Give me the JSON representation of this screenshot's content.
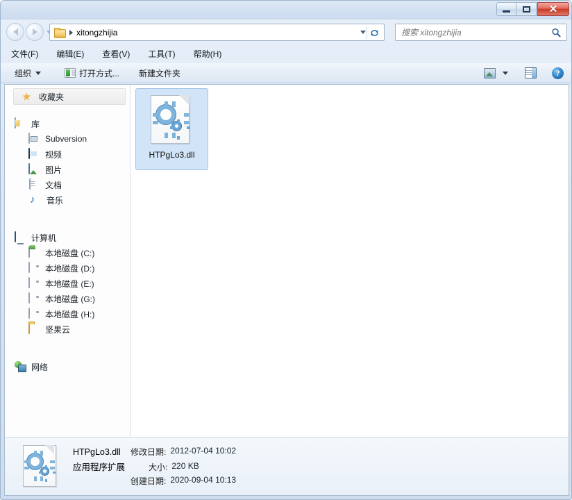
{
  "window": {
    "controls": {
      "minimize_label": "—",
      "maximize_label": "□",
      "close_label": "✕"
    }
  },
  "address_bar": {
    "crumb": "xitongzhijia",
    "back_icon": "back-arrow-icon",
    "forward_icon": "forward-arrow-icon",
    "history_icon": "chevron-down-icon",
    "folder_icon": "folder-icon",
    "refresh_icon": "refresh-icon",
    "refresh_glyph": "↯"
  },
  "search": {
    "placeholder": "搜索 xitongzhijia",
    "value": "",
    "icon": "search-icon"
  },
  "menu": {
    "items": [
      {
        "label": "文件(F)"
      },
      {
        "label": "编辑(E)"
      },
      {
        "label": "查看(V)"
      },
      {
        "label": "工具(T)"
      },
      {
        "label": "帮助(H)"
      }
    ]
  },
  "toolbar": {
    "organize_label": "组织",
    "open_with_label": "打开方式...",
    "new_folder_label": "新建文件夹",
    "view_icon": "view-mode-icon",
    "view_caret_icon": "chevron-down-icon",
    "preview_pane_icon": "preview-pane-icon",
    "help_icon": "help-icon",
    "help_glyph": "?"
  },
  "sidebar": {
    "favorites": {
      "label": "收藏夹",
      "icon": "star-icon"
    },
    "groups": [
      {
        "label": "库",
        "icon": "library-icon",
        "children": [
          {
            "label": "Subversion",
            "icon": "subversion-icon"
          },
          {
            "label": "视频",
            "icon": "video-icon"
          },
          {
            "label": "图片",
            "icon": "picture-icon"
          },
          {
            "label": "文档",
            "icon": "document-icon"
          },
          {
            "label": "音乐",
            "icon": "music-icon",
            "glyph": "♪"
          }
        ]
      },
      {
        "label": "计算机",
        "icon": "computer-icon",
        "children": [
          {
            "label": "本地磁盘 (C:)",
            "icon": "system-drive-icon"
          },
          {
            "label": "本地磁盘 (D:)",
            "icon": "drive-icon"
          },
          {
            "label": "本地磁盘 (E:)",
            "icon": "drive-icon"
          },
          {
            "label": "本地磁盘 (G:)",
            "icon": "drive-icon"
          },
          {
            "label": "本地磁盘 (H:)",
            "icon": "drive-icon"
          },
          {
            "label": "坚果云",
            "icon": "folder-icon"
          }
        ]
      },
      {
        "label": "网络",
        "icon": "network-icon",
        "children": []
      }
    ]
  },
  "files": [
    {
      "name": "HTPgLo3.dll",
      "icon": "dll-file-icon",
      "selected": true
    }
  ],
  "status": {
    "file_name": "HTPgLo3.dll",
    "file_kind": "应用程序扩展",
    "modified_label": "修改日期:",
    "modified_value": "2012-07-04 10:02",
    "size_label": "大小:",
    "size_value": "220 KB",
    "created_label": "创建日期:",
    "created_value": "2020-09-04 10:13",
    "icon": "dll-file-icon"
  },
  "colors": {
    "title_bar": "#d3e0f0",
    "close_button": "#c83a26",
    "selection": "#d2e4f7",
    "accent": "#2a6fa8"
  }
}
